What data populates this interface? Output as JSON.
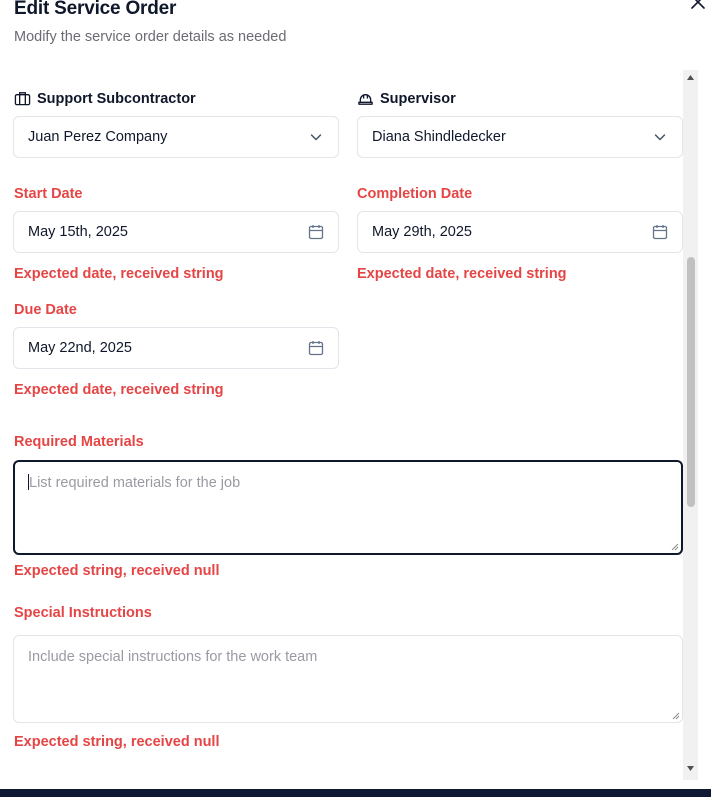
{
  "dialog": {
    "title": "Edit Service Order",
    "subtitle": "Modify the service order details as needed"
  },
  "fields": {
    "subcontractor": {
      "label": "Support Subcontractor",
      "value": "Juan Perez Company",
      "icon": "building-icon"
    },
    "supervisor": {
      "label": "Supervisor",
      "value": "Diana Shindledecker",
      "icon": "hard-hat-icon"
    },
    "start_date": {
      "label": "Start Date",
      "value": "May 15th, 2025",
      "error": "Expected date, received string"
    },
    "completion_date": {
      "label": "Completion Date",
      "value": "May 29th, 2025",
      "error": "Expected date, received string"
    },
    "due_date": {
      "label": "Due Date",
      "value": "May 22nd, 2025",
      "error": "Expected date, received string"
    },
    "required_materials": {
      "label": "Required Materials",
      "placeholder": "List required materials for the job",
      "error": "Expected string, received null"
    },
    "special_instructions": {
      "label": "Special Instructions",
      "placeholder": "Include special instructions for the work team",
      "error": "Expected string, received null"
    }
  },
  "colors": {
    "error": "#e54545",
    "text": "#0f172a",
    "muted": "#6b6b75",
    "border": "#e2e5ea",
    "footer_bar": "#101932"
  }
}
